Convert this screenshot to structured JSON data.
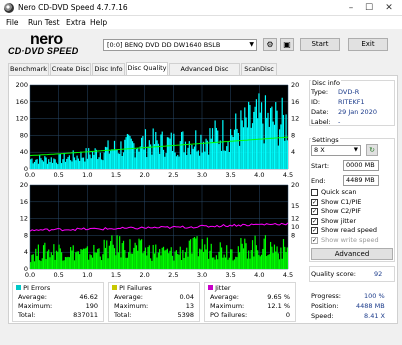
{
  "window": {
    "title": "Nero CD-DVD Speed 4.7.7.16"
  },
  "menu": [
    "File",
    "Run Test",
    "Extra",
    "Help"
  ],
  "logo": {
    "main": "nero",
    "sub": "CD·DVD SPEED"
  },
  "drive": {
    "selected": "[0:0]  BENQ DVD DD DW1640 BSLB"
  },
  "toolbar": {
    "start": "Start",
    "exit": "Exit"
  },
  "tabs": [
    "Benchmark",
    "Create Disc",
    "Disc Info",
    "Disc Quality",
    "Advanced Disc Quality",
    "ScanDisc"
  ],
  "active_tab": "Disc Quality",
  "disc_info": {
    "header": "Disc info",
    "type_label": "Type:",
    "type": "DVD-R",
    "id_label": "ID:",
    "id": "RITEKF1",
    "date_label": "Date:",
    "date": "29 Jan 2020",
    "label_label": "Label:",
    "label": "-"
  },
  "settings": {
    "header": "Settings",
    "speed": "8 X",
    "start_label": "Start:",
    "start": "0000 MB",
    "end_label": "End:",
    "end": "4489 MB",
    "checks": [
      {
        "label": "Quick scan",
        "checked": false,
        "enabled": true
      },
      {
        "label": "Show C1/PIE",
        "checked": true,
        "enabled": true
      },
      {
        "label": "Show C2/PIF",
        "checked": true,
        "enabled": true
      },
      {
        "label": "Show jitter",
        "checked": true,
        "enabled": true
      },
      {
        "label": "Show read speed",
        "checked": true,
        "enabled": true
      },
      {
        "label": "Show write speed",
        "checked": true,
        "enabled": false
      }
    ],
    "advanced": "Advanced"
  },
  "quality": {
    "label": "Quality score:",
    "value": "92"
  },
  "progress": {
    "progress_label": "Progress:",
    "progress": "100 %",
    "position_label": "Position:",
    "position": "4488 MB",
    "speed_label": "Speed:",
    "speed": "8.41 X"
  },
  "pi_errors": {
    "title": "PI Errors",
    "color": "#00c8c8",
    "avg_label": "Average:",
    "avg": "46.62",
    "max_label": "Maximum:",
    "max": "190",
    "total_label": "Total:",
    "total": "837011"
  },
  "pi_failures": {
    "title": "PI Failures",
    "color": "#c8c800",
    "avg_label": "Average:",
    "avg": "0.04",
    "max_label": "Maximum:",
    "max": "13",
    "total_label": "Total:",
    "total": "5398"
  },
  "jitter": {
    "title": "Jitter",
    "color": "#c800c8",
    "avg_label": "Average:",
    "avg": "9.65 %",
    "max_label": "Maximum:",
    "max": "12.1 %",
    "po_label": "PO failures:",
    "po": "0"
  },
  "chart_data": [
    {
      "type": "area",
      "name": "PI Errors",
      "x": [
        0,
        0.5,
        1.0,
        1.5,
        2.0,
        2.5,
        3.0,
        3.5,
        4.0,
        4.5
      ],
      "series": [
        {
          "name": "PI Errors",
          "color": "#00ffff",
          "values": [
            26,
            26,
            38,
            55,
            70,
            68,
            80,
            95,
            130,
            120
          ]
        },
        {
          "name": "Read speed",
          "color": "#00ff00",
          "values": [
            3.2,
            3.6,
            4.1,
            4.6,
            5.1,
            5.6,
            6.1,
            6.6,
            7.1,
            7.6
          ],
          "axis": "right"
        }
      ],
      "xlim": [
        0,
        4.5
      ],
      "ylim": [
        0,
        200
      ],
      "y_ticks": [
        0,
        40,
        80,
        120,
        160,
        200
      ],
      "y2_ticks": [
        4,
        8,
        12,
        16,
        20
      ],
      "y2lim": [
        0,
        20
      ],
      "x_ticks": [
        "0.0",
        "0.5",
        "1.0",
        "1.5",
        "2.0",
        "2.5",
        "3.0",
        "3.5",
        "4.0",
        "4.5"
      ],
      "grid": true
    },
    {
      "type": "bar",
      "name": "PI Failures / Jitter",
      "x": [
        0,
        0.5,
        1.0,
        1.5,
        2.0,
        2.5,
        3.0,
        3.5,
        4.0,
        4.5
      ],
      "series": [
        {
          "name": "PI Failures",
          "color": "#00ff00",
          "values": [
            4,
            5,
            4,
            6,
            5,
            4,
            6,
            5,
            6,
            5
          ]
        },
        {
          "name": "Jitter",
          "color": "#ff00ff",
          "values": [
            9.2,
            9.4,
            9.5,
            9.6,
            9.8,
            9.9,
            10.1,
            10.4,
            10.6,
            10.8
          ],
          "axis": "right"
        }
      ],
      "xlim": [
        0,
        4.5
      ],
      "ylim": [
        0,
        20
      ],
      "y_ticks": [
        0,
        4,
        8,
        12,
        16,
        20
      ],
      "y2_ticks": [
        8,
        10,
        12,
        15,
        20
      ],
      "y2lim": [
        0,
        20
      ],
      "x_ticks": [
        "0.0",
        "0.5",
        "1.0",
        "1.5",
        "2.0",
        "2.5",
        "3.0",
        "3.5",
        "4.0",
        "4.5"
      ],
      "grid": true
    }
  ],
  "statusbar": {
    "text": ""
  }
}
